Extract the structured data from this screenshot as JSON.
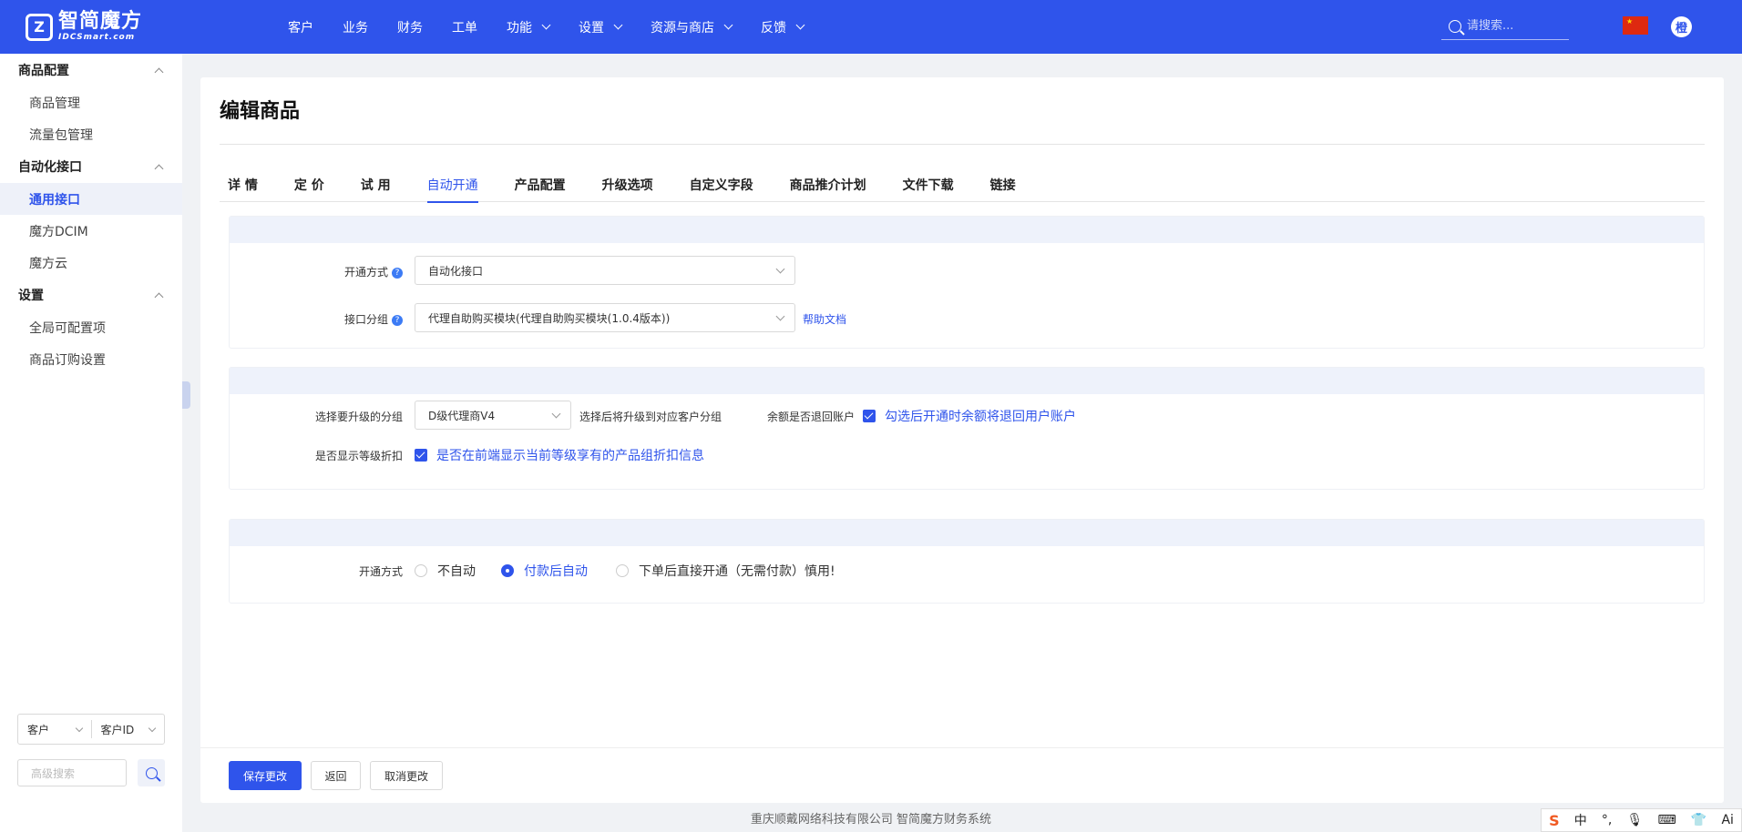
{
  "brand": {
    "cn": "智简魔方",
    "en": "IDCSmart.com"
  },
  "nav": [
    {
      "label": "客户",
      "dropdown": false
    },
    {
      "label": "业务",
      "dropdown": false
    },
    {
      "label": "财务",
      "dropdown": false
    },
    {
      "label": "工单",
      "dropdown": false
    },
    {
      "label": "功能",
      "dropdown": true
    },
    {
      "label": "设置",
      "dropdown": true
    },
    {
      "label": "资源与商店",
      "dropdown": true
    },
    {
      "label": "反馈",
      "dropdown": true
    }
  ],
  "search": {
    "placeholder": "请搜索..."
  },
  "flag": {
    "icon": "china-flag-icon"
  },
  "avatar": {
    "initial": "橙"
  },
  "sidebar": {
    "groups": [
      {
        "label": "商品配置",
        "items": [
          {
            "label": "商品管理"
          },
          {
            "label": "流量包管理"
          }
        ]
      },
      {
        "label": "自动化接口",
        "items": [
          {
            "label": "通用接口",
            "active": true
          },
          {
            "label": "魔方DCIM"
          },
          {
            "label": "魔方云"
          }
        ]
      },
      {
        "label": "设置",
        "items": [
          {
            "label": "全局可配置项"
          },
          {
            "label": "商品订购设置"
          }
        ]
      }
    ],
    "filter1": "客户",
    "filter2": "客户ID",
    "advanced_placeholder": "高级搜索"
  },
  "page": {
    "title": "编辑商品"
  },
  "tabs": [
    {
      "label": "详 情"
    },
    {
      "label": "定 价"
    },
    {
      "label": "试 用"
    },
    {
      "label": "自动开通",
      "active": true
    },
    {
      "label": "产品配置"
    },
    {
      "label": "升级选项"
    },
    {
      "label": "自定义字段"
    },
    {
      "label": "商品推介计划"
    },
    {
      "label": "文件下载"
    },
    {
      "label": "链接"
    }
  ],
  "provision": {
    "method_label": "开通方式",
    "method_value": "自动化接口",
    "group_label": "接口分组",
    "group_value": "代理自助购买模块(代理自助购买模块(1.0.4版本))",
    "help_link": "帮助文档"
  },
  "upgrade": {
    "group_label": "选择要升级的分组",
    "group_value": "D级代理商V4",
    "group_hint": "选择后将升级到对应客户分组",
    "refund_label": "余额是否退回账户",
    "refund_check": "勾选后开通时余额将退回用户账户",
    "discount_label": "是否显示等级折扣",
    "discount_check": "是否在前端显示当前等级享有的产品组折扣信息"
  },
  "auto": {
    "label": "开通方式",
    "options": [
      {
        "label": "不自动",
        "checked": false
      },
      {
        "label": "付款后自动",
        "checked": true
      },
      {
        "label": "下单后直接开通（无需付款）慎用!",
        "checked": false
      }
    ]
  },
  "buttons": {
    "save": "保存更改",
    "back": "返回",
    "cancel": "取消更改"
  },
  "footer": {
    "copyright": "重庆顺戴网络科技有限公司 智简魔方财务系统"
  },
  "ime": {
    "logo": "S",
    "mode": "中",
    "punct": "°,",
    "icons": [
      "microphone-icon",
      "keyboard-icon",
      "shirt-icon",
      "ai-icon"
    ],
    "ai": "Ai"
  }
}
